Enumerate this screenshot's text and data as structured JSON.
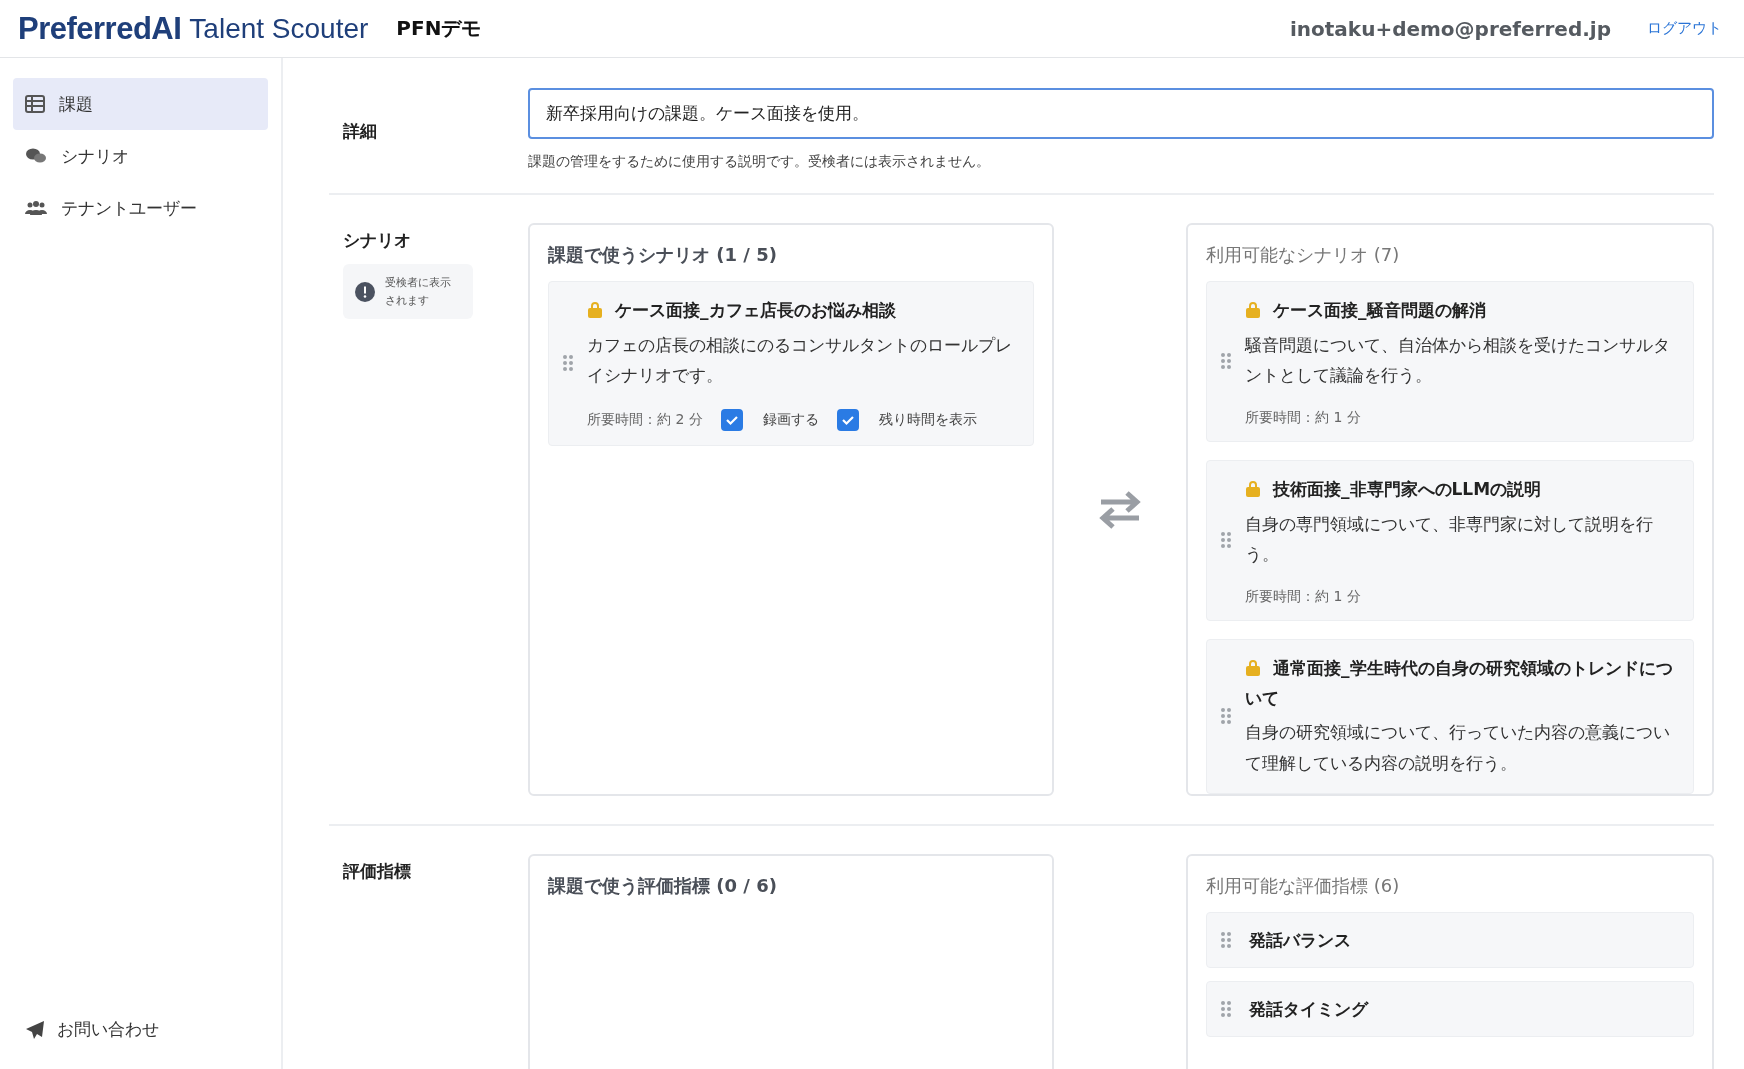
{
  "header": {
    "brand": "PreferredAI",
    "product": "Talent Scouter",
    "tenant": "PFNデモ",
    "user": "inotaku+demo@preferred.jp",
    "logout": "ログアウト"
  },
  "sidebar": {
    "items": [
      {
        "label": "課題",
        "kind": "table",
        "selected": true
      },
      {
        "label": "シナリオ",
        "kind": "chat",
        "selected": false
      },
      {
        "label": "テナントユーザー",
        "kind": "users",
        "selected": false
      }
    ],
    "footer_link": "お問い合わせ"
  },
  "detail": {
    "label": "詳細",
    "value": "新卒採用向けの課題。ケース面接を使用。",
    "hint": "課題の管理をするために使用する説明です。受検者には表示されません。"
  },
  "scenarios": {
    "label": "シナリオ",
    "note": "受検者に表示されます",
    "used": {
      "title": "課題で使うシナリオ (1 / 5)",
      "items": [
        {
          "title": "ケース面接_カフェ店長のお悩み相談",
          "description": "カフェの店長の相談にのるコンサルタントのロールプレイシナリオです。",
          "duration": "所要時間：約 2 分",
          "options": [
            {
              "label": "録画する",
              "checked": true
            },
            {
              "label": "残り時間を表示",
              "checked": true
            }
          ]
        }
      ]
    },
    "available": {
      "title": "利用可能なシナリオ (7)",
      "items": [
        {
          "title": "ケース面接_騒音問題の解消",
          "description": "騒音問題について、自治体から相談を受けたコンサルタントとして議論を行う。",
          "duration": "所要時間：約 1 分"
        },
        {
          "title": "技術面接_非専門家へのLLMの説明",
          "description": "自身の専門領域について、非専門家に対して説明を行う。",
          "duration": "所要時間：約 1 分"
        },
        {
          "title": "通常面接_学生時代の自身の研究領域のトレンドについて",
          "description": "自身の研究領域について、行っていた内容の意義について理解している内容の説明を行う。"
        }
      ]
    }
  },
  "metrics": {
    "label": "評価指標",
    "used": {
      "title": "課題で使う評価指標 (0 / 6)"
    },
    "available": {
      "title": "利用可能な評価指標 (6)",
      "items": [
        {
          "title": "発話バランス"
        },
        {
          "title": "発話タイミング"
        }
      ]
    }
  }
}
